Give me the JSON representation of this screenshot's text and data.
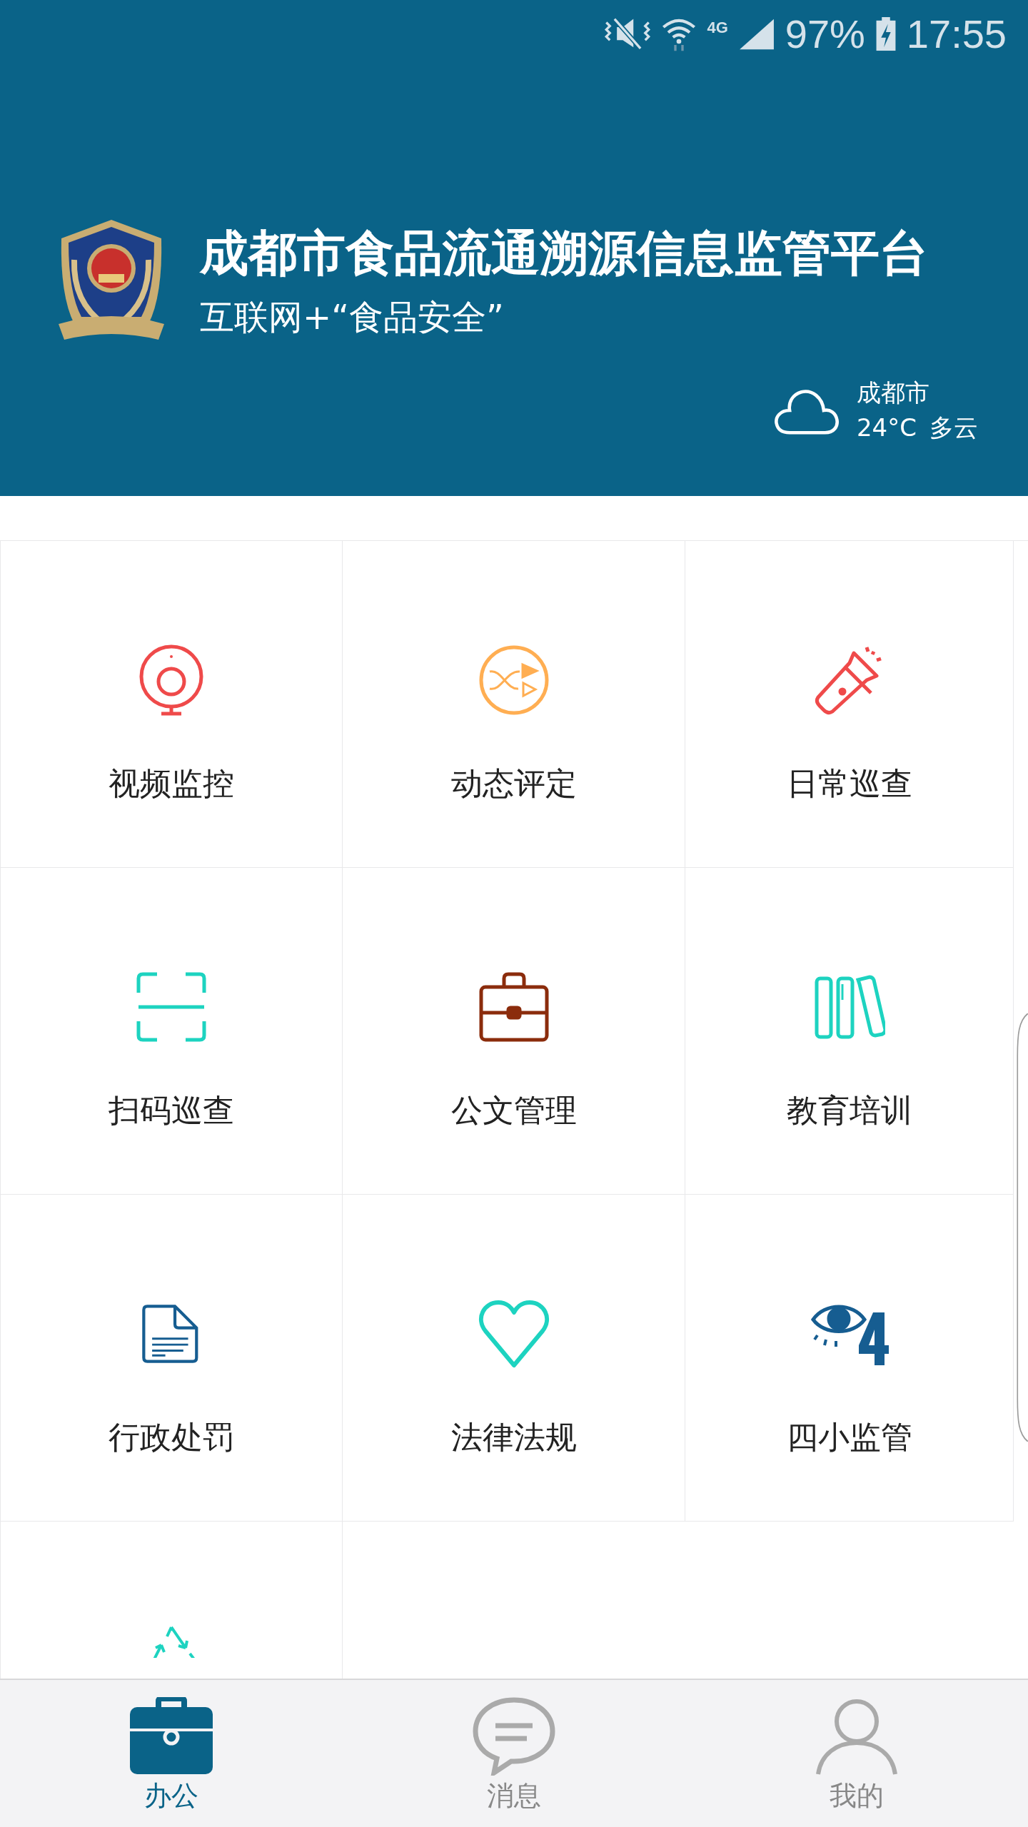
{
  "status_bar": {
    "network": "4G",
    "battery": "97%",
    "time": "17:55"
  },
  "header": {
    "title": "成都市食品流通溯源信息监管平台",
    "subtitle": "互联网+“食品安全”",
    "weather": {
      "city": "成都市",
      "temperature": "24°C",
      "condition": "多云"
    }
  },
  "grid": [
    {
      "kind": "webcam",
      "label": "视频监控"
    },
    {
      "kind": "shuffle",
      "label": "动态评定"
    },
    {
      "kind": "flashlight",
      "label": "日常巡查"
    },
    {
      "kind": "scan",
      "label": "扫码巡查"
    },
    {
      "kind": "briefcase",
      "label": "公文管理"
    },
    {
      "kind": "books",
      "label": "教育培训"
    },
    {
      "kind": "document",
      "label": "行政处罚"
    },
    {
      "kind": "heart",
      "label": "法律法规"
    },
    {
      "kind": "eye",
      "label": "四小监管"
    },
    {
      "kind": "recycle"
    }
  ],
  "tab_bar": [
    {
      "kind": "briefcase",
      "label": "办公",
      "selected": true
    },
    {
      "kind": "chat",
      "label": "消息",
      "selected": false
    },
    {
      "kind": "person",
      "label": "我的",
      "selected": false
    }
  ]
}
